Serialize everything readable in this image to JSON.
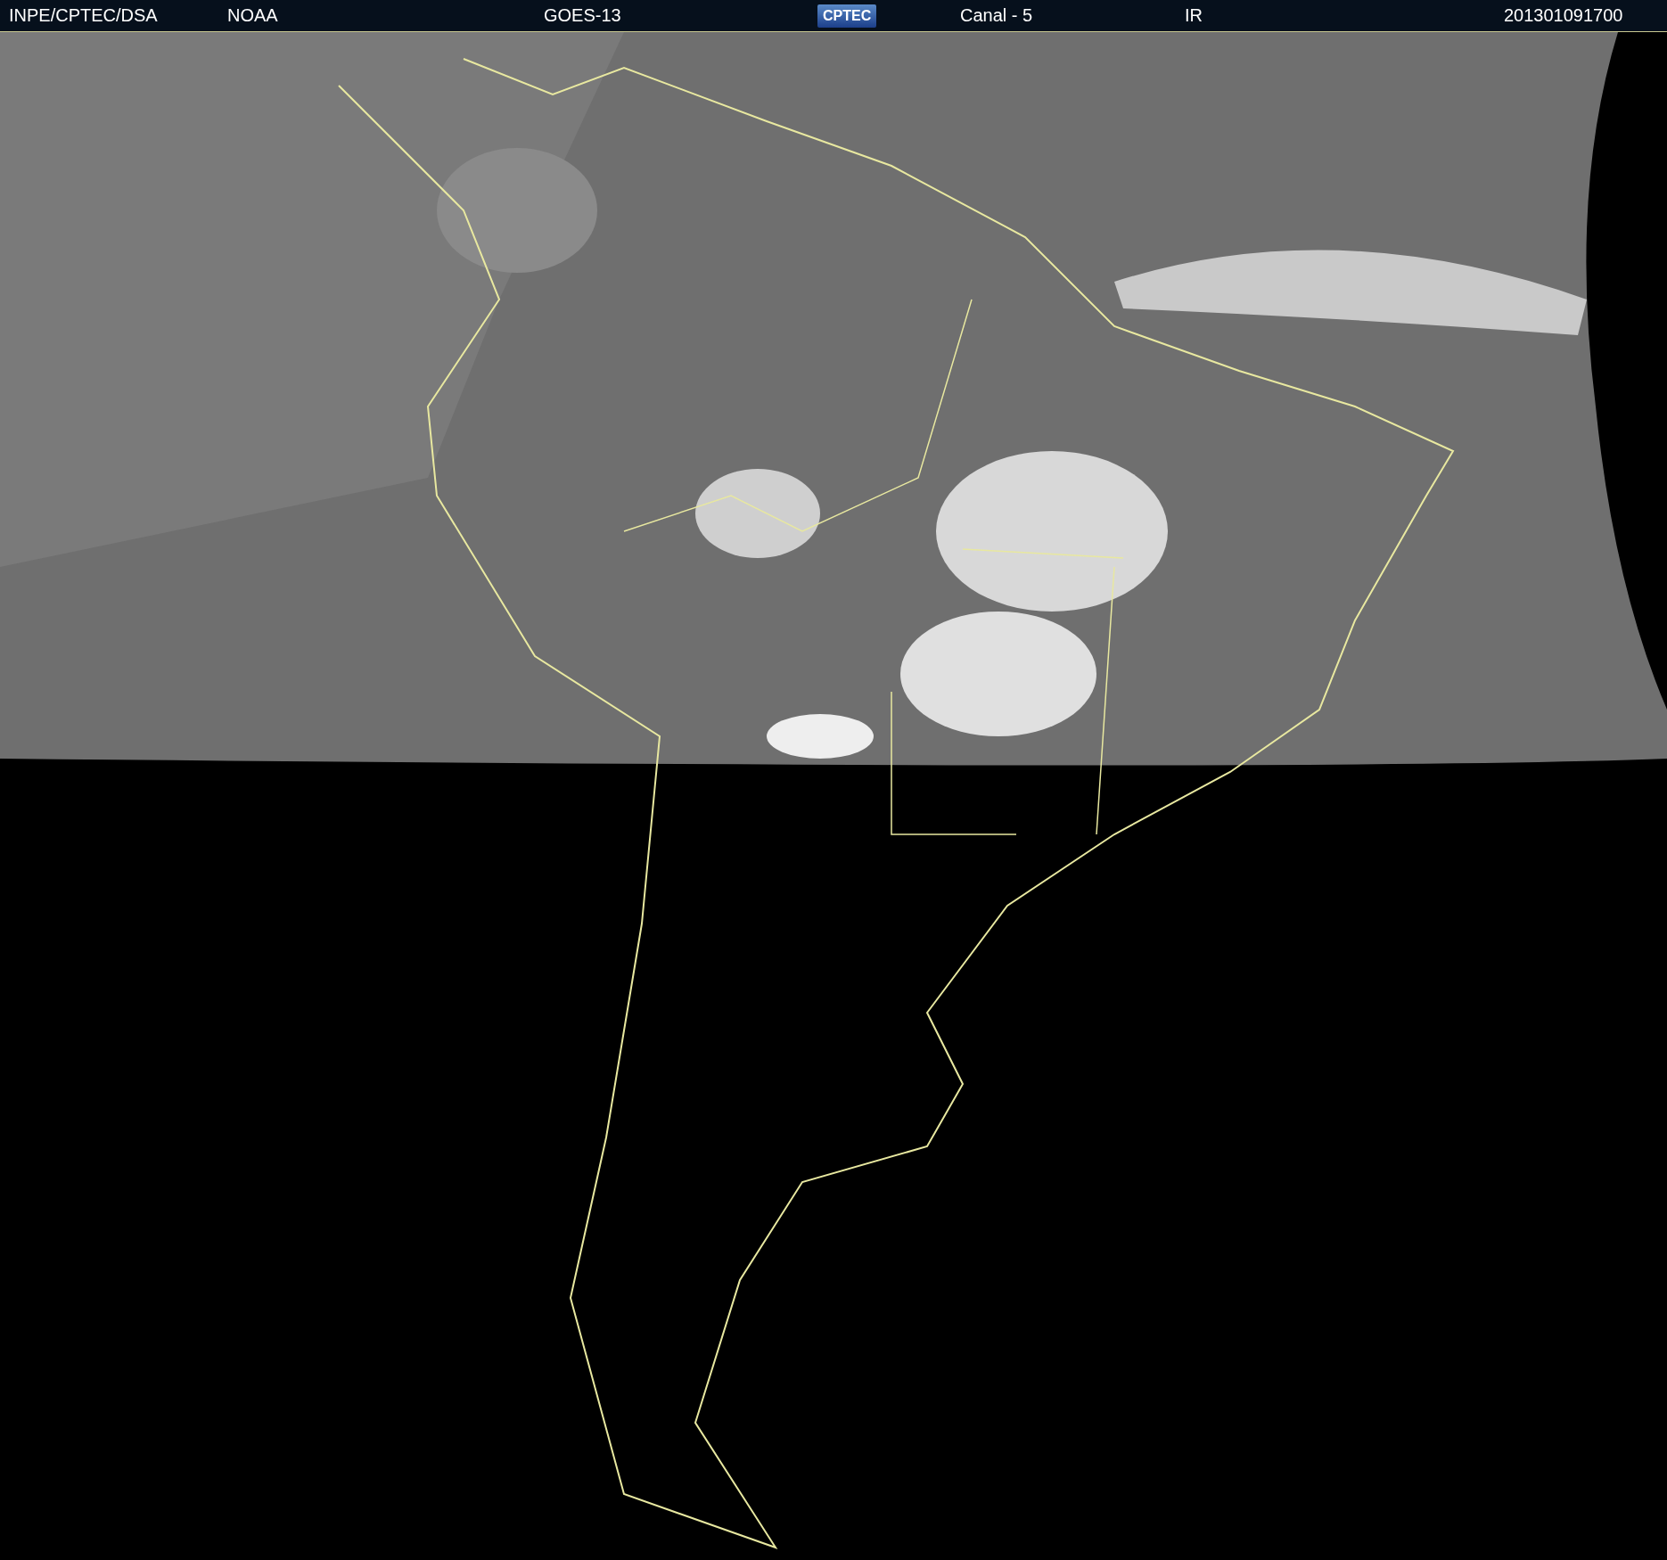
{
  "header": {
    "items": [
      {
        "kind": "text",
        "text": "INPE/CPTEC/DSA"
      },
      {
        "kind": "text",
        "text": "NOAA"
      },
      {
        "kind": "text",
        "text": "GOES-13"
      },
      {
        "kind": "logo",
        "text": "CPTEC"
      },
      {
        "kind": "text",
        "text": "Canal - 5"
      },
      {
        "kind": "text",
        "text": "IR"
      },
      {
        "kind": "text",
        "text": "201301091700"
      }
    ]
  }
}
